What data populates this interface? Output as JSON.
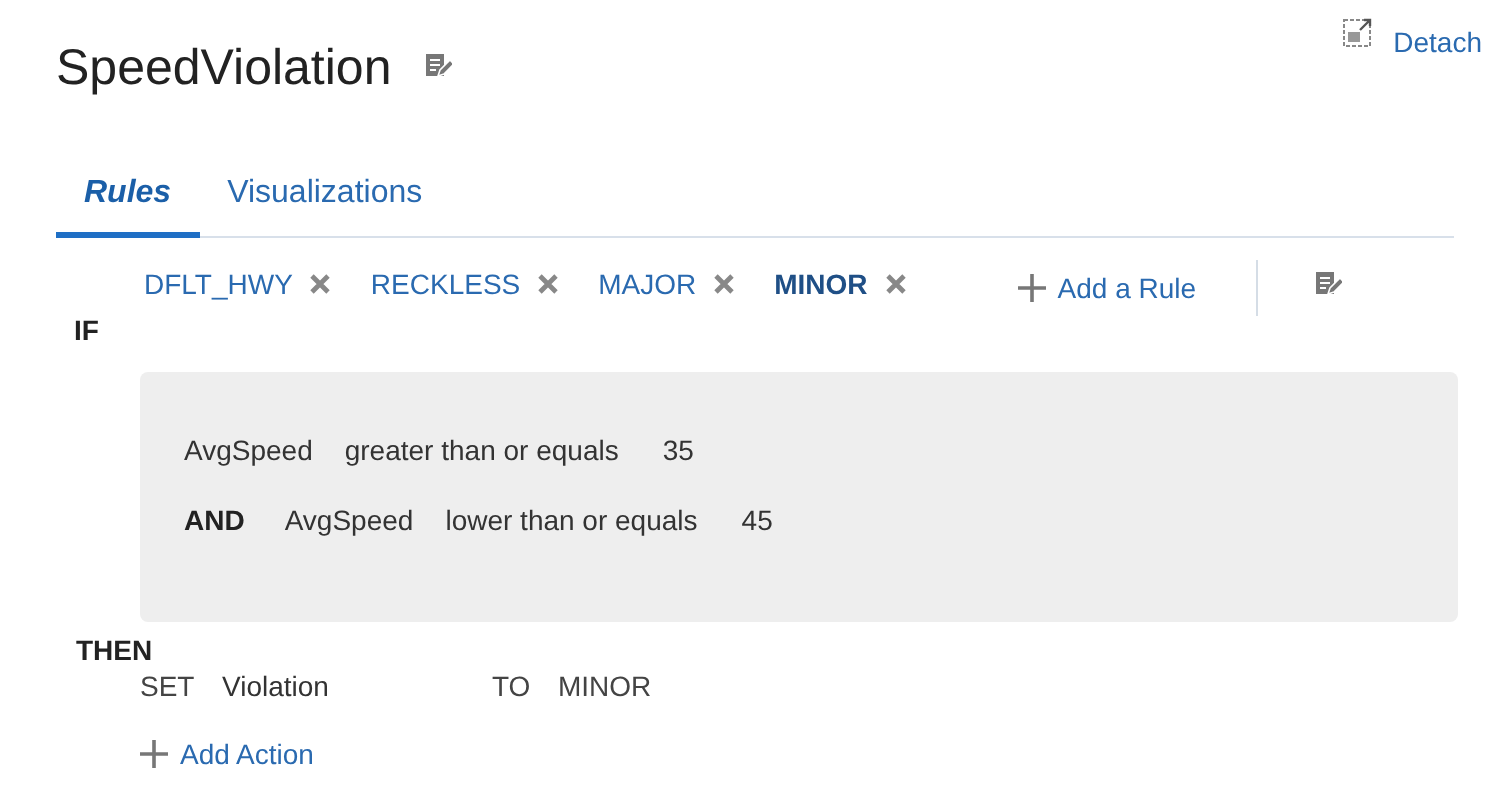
{
  "title": "SpeedViolation",
  "detach": "Detach",
  "tabs": [
    {
      "label": "Rules",
      "selected": true
    },
    {
      "label": "Visualizations",
      "selected": false
    }
  ],
  "rules": [
    {
      "label": "DFLT_HWY",
      "selected": false
    },
    {
      "label": "RECKLESS",
      "selected": false
    },
    {
      "label": "MAJOR",
      "selected": false
    },
    {
      "label": "MINOR",
      "selected": true
    }
  ],
  "add_rule": "Add a Rule",
  "if_label": "IF",
  "conditions": [
    {
      "field": "AvgSpeed",
      "operator": "greater than or equals",
      "value": "35"
    },
    {
      "connector": "AND",
      "field": "AvgSpeed",
      "operator": "lower than or equals",
      "value": "45"
    }
  ],
  "then_label": "THEN",
  "actions": [
    {
      "verb": "SET",
      "target": "Violation",
      "to": "TO",
      "value": "MINOR"
    }
  ],
  "add_action": "Add Action"
}
